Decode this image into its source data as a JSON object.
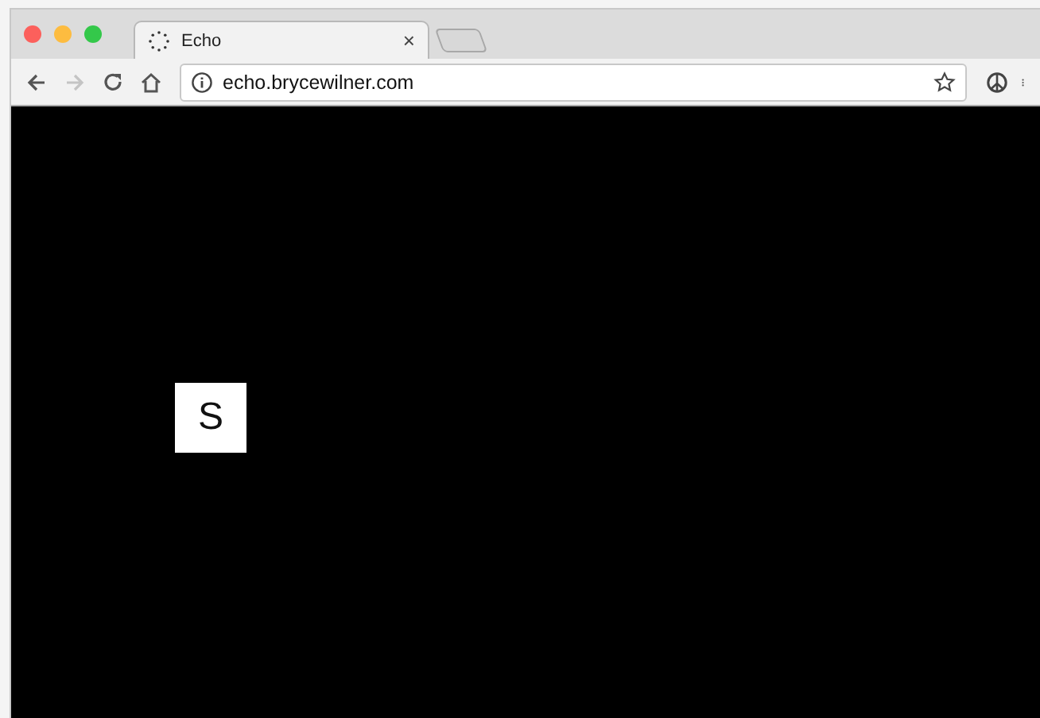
{
  "tabs": [
    {
      "title": "Echo",
      "close": "×",
      "selected": true
    }
  ],
  "toolbar": {
    "buttons": [
      {
        "kind": "back",
        "disabled": false
      },
      {
        "kind": "forward",
        "disabled": true
      },
      {
        "kind": "reload",
        "disabled": false
      },
      {
        "kind": "home",
        "disabled": false
      }
    ],
    "address": "echo.brycewilner.com"
  },
  "page": {
    "key": "S"
  }
}
